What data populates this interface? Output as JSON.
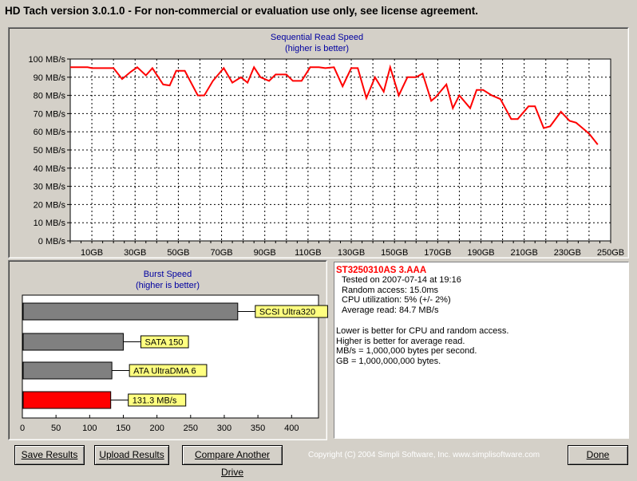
{
  "window": {
    "title": "HD Tach version 3.0.1.0  - For non-commercial or evaluation use only, see license agreement."
  },
  "read_chart": {
    "title": "Sequential Read Speed",
    "subtitle": "(higher is better)",
    "line_color": "#ff0000",
    "grid": true
  },
  "burst_chart": {
    "title": "Burst Speed",
    "subtitle": "(higher is better)"
  },
  "chart_data": [
    {
      "type": "line",
      "title": "Sequential Read Speed",
      "subtitle": "(higher is better)",
      "xlabel": "",
      "ylabel": "",
      "x_ticks": [
        "10GB",
        "30GB",
        "50GB",
        "70GB",
        "90GB",
        "110GB",
        "130GB",
        "150GB",
        "170GB",
        "190GB",
        "210GB",
        "230GB",
        "250GB"
      ],
      "y_ticks": [
        "0 MB/s",
        "10 MB/s",
        "20 MB/s",
        "30 MB/s",
        "40 MB/s",
        "50 MB/s",
        "60 MB/s",
        "70 MB/s",
        "80 MB/s",
        "90 MB/s",
        "100 MB/s"
      ],
      "xlim": [
        0,
        250
      ],
      "ylim": [
        0,
        100
      ],
      "series": [
        {
          "color": "#ff0000",
          "points": [
            [
              0,
              95.5
            ],
            [
              8,
              95.5
            ],
            [
              10,
              95
            ],
            [
              20,
              95
            ],
            [
              24,
              89
            ],
            [
              28,
              93
            ],
            [
              31,
              95.5
            ],
            [
              35,
              91
            ],
            [
              38,
              95
            ],
            [
              43,
              86
            ],
            [
              46,
              85.5
            ],
            [
              49,
              93.5
            ],
            [
              53,
              93.5
            ],
            [
              59,
              80
            ],
            [
              62,
              80
            ],
            [
              66,
              88
            ],
            [
              71,
              95
            ],
            [
              75,
              87
            ],
            [
              79,
              90
            ],
            [
              82,
              87
            ],
            [
              85,
              95.5
            ],
            [
              88,
              90
            ],
            [
              92,
              88
            ],
            [
              95,
              91.5
            ],
            [
              100,
              91.5
            ],
            [
              103,
              88
            ],
            [
              107,
              88
            ],
            [
              111,
              95.5
            ],
            [
              115,
              95.5
            ],
            [
              118,
              95
            ],
            [
              122,
              95.5
            ],
            [
              126,
              85
            ],
            [
              130,
              95
            ],
            [
              133,
              95
            ],
            [
              137,
              78.5
            ],
            [
              141,
              90
            ],
            [
              145,
              82
            ],
            [
              148,
              95.5
            ],
            [
              152,
              80
            ],
            [
              156,
              90
            ],
            [
              160,
              90
            ],
            [
              163,
              92
            ],
            [
              167,
              77
            ],
            [
              169,
              79
            ],
            [
              174,
              86
            ],
            [
              177,
              73
            ],
            [
              180,
              80
            ],
            [
              185,
              73
            ],
            [
              188,
              83
            ],
            [
              191,
              83
            ],
            [
              195,
              80
            ],
            [
              199,
              78
            ],
            [
              204,
              67
            ],
            [
              207,
              67
            ],
            [
              212,
              74
            ],
            [
              215,
              74
            ],
            [
              219,
              62
            ],
            [
              222,
              63
            ],
            [
              227,
              71
            ],
            [
              231,
              66
            ],
            [
              234,
              65
            ],
            [
              237,
              62
            ],
            [
              240,
              59
            ],
            [
              242,
              56
            ],
            [
              244,
              53
            ]
          ]
        }
      ]
    },
    {
      "type": "bar",
      "orientation": "horizontal",
      "title": "Burst Speed",
      "subtitle": "(higher is better)",
      "x_ticks": [
        "0",
        "50",
        "100",
        "150",
        "200",
        "250",
        "300",
        "350",
        "400"
      ],
      "xlim": [
        0,
        440
      ],
      "categories": [
        "SCSI Ultra320",
        "SATA 150",
        "ATA UltraDMA 6",
        "131.3 MB/s"
      ],
      "values": [
        320,
        150,
        133,
        131.3
      ],
      "colors": [
        "#808080",
        "#808080",
        "#808080",
        "#ff0000"
      ],
      "label_bg": "#ffff80"
    }
  ],
  "info": {
    "drive": "ST3250310AS 3.AAA",
    "tested_on": "Tested on 2007-07-14 at 19:16",
    "random_access": "Random access: 15.0ms",
    "cpu": "CPU utilization: 5% (+/- 2%)",
    "average": "Average read: 84.7 MB/s",
    "notes": [
      "Lower is better for CPU and random access.",
      "Higher is better for average read.",
      "MB/s = 1,000,000 bytes per second.",
      "GB = 1,000,000,000 bytes."
    ]
  },
  "buttons": {
    "save": "Save Results",
    "upload": "Upload Results",
    "compare": "Compare Another Drive",
    "done": "Done"
  },
  "footer": {
    "copyright": "Copyright (C) 2004 Simpli Software, Inc. www.simplisoftware.com"
  }
}
